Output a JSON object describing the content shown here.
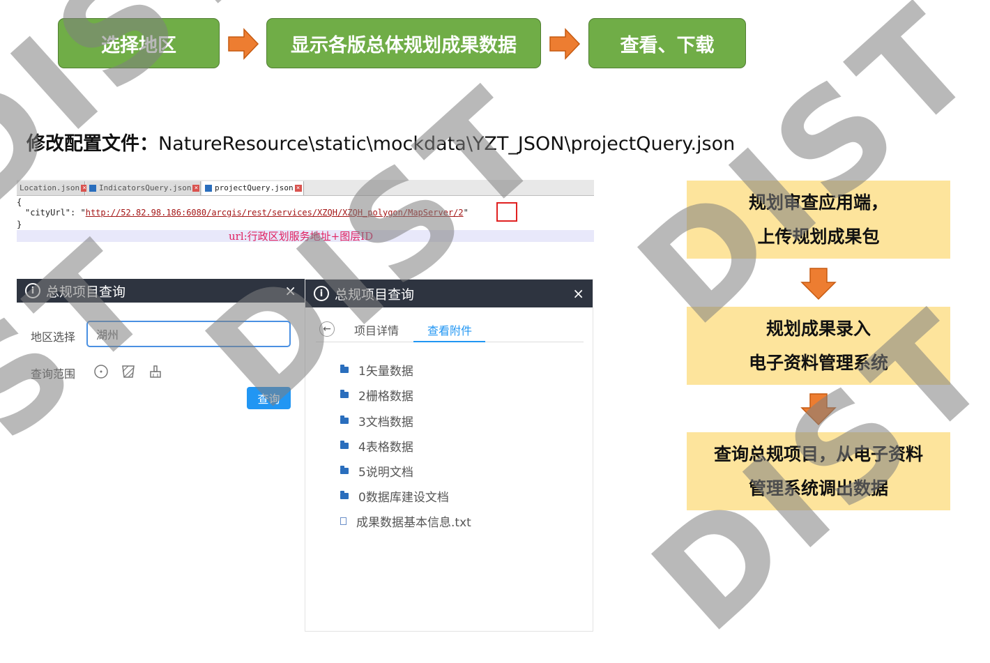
{
  "flow": {
    "steps": [
      "选择地区",
      "显示各版总体规划成果数据",
      "查看、下载"
    ],
    "step_color": "#70ad47",
    "arrow_color": "#ed7d31"
  },
  "caption": {
    "label": "修改配置文件：",
    "path": "NatureResource\\static\\mockdata\\YZT_JSON\\projectQuery.json"
  },
  "editor": {
    "tabs": [
      "Location.json",
      "IndicatorsQuery.json",
      "projectQuery.json"
    ],
    "active_tab": "projectQuery.json",
    "line1": "{",
    "key": "\"cityUrl\": ",
    "quote_open": "\"",
    "url": "http://52.82.98.186:6080/arcgis/rest/services/XZQH/XZQH_polygon/MapServer/",
    "layer_id": "2",
    "quote_close": "\"",
    "line3": "}",
    "annotation": "url:行政区划服务地址+图层ID"
  },
  "panel_left": {
    "title": "总规项目查询",
    "close": "×",
    "region_label": "地区选择",
    "region_value": "湖州",
    "range_label": "查询范围",
    "query_button": "查询"
  },
  "panel_right": {
    "title": "总规项目查询",
    "close": "×",
    "back": "←",
    "tabs": [
      "项目详情",
      "查看附件"
    ],
    "active_tab": "查看附件",
    "files": [
      {
        "name": "1矢量数据",
        "type": "folder"
      },
      {
        "name": "2栅格数据",
        "type": "folder"
      },
      {
        "name": "3文档数据",
        "type": "folder"
      },
      {
        "name": "4表格数据",
        "type": "folder"
      },
      {
        "name": "5说明文档",
        "type": "folder"
      },
      {
        "name": "0数据库建设文档",
        "type": "folder"
      },
      {
        "name": "成果数据基本信息.txt",
        "type": "file"
      }
    ]
  },
  "process": {
    "box1": [
      "规划审查应用端，",
      "上传规划成果包"
    ],
    "box2": [
      "规划成果录入",
      "电子资料管理系统"
    ],
    "box3": [
      "查询总规项目，从电子资料",
      "管理系统调出数据"
    ],
    "box_color": "#fde49c"
  },
  "watermark": "DIST"
}
